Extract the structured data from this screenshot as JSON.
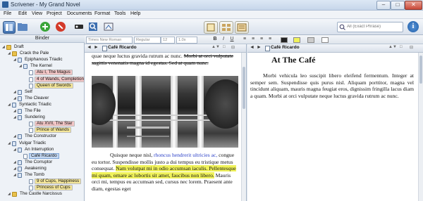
{
  "window": {
    "title": "Scrivener - My Grand Novel",
    "controls": [
      "–",
      "□",
      "✕"
    ]
  },
  "menu": [
    "File",
    "Edit",
    "View",
    "Project",
    "Documents",
    "Format",
    "Tools",
    "Help"
  ],
  "toolbar": {
    "icons": [
      "binder-toggle-icon",
      "folder-icon",
      "add-icon",
      "trash-icon",
      "keywords-icon",
      "search-icon",
      "compile-icon",
      "view-document-icon",
      "view-corkboard-icon",
      "view-outline-icon"
    ],
    "search_placeholder": "All (Exact Phrase)",
    "info_label": "i"
  },
  "binder": {
    "header": "Binder",
    "items": [
      {
        "label": "Draft",
        "level": 0,
        "icon": "draft"
      },
      {
        "label": "Crack the Pale",
        "level": 1,
        "icon": "folder"
      },
      {
        "label": "Epiphanous Triadic",
        "level": 2,
        "icon": "docs"
      },
      {
        "label": "The Kernel",
        "level": 3,
        "icon": "docs"
      },
      {
        "label": "Atu I, The Magus",
        "level": 4,
        "icon": "doc",
        "color": "#f3c6c6"
      },
      {
        "label": "4 of Wands, Completion",
        "level": 4,
        "icon": "doc",
        "color": "#f3c6c6"
      },
      {
        "label": "Queen of Swords",
        "level": 4,
        "icon": "doc",
        "color": "#f5e79a"
      },
      {
        "label": "Self",
        "level": 2,
        "icon": "docs"
      },
      {
        "label": "The Cleaver",
        "level": 2,
        "icon": "docs"
      },
      {
        "label": "Syntactic Triadic",
        "level": 1,
        "icon": "docs"
      },
      {
        "label": "The File",
        "level": 2,
        "icon": "docs"
      },
      {
        "label": "Sundering",
        "level": 2,
        "icon": "docs"
      },
      {
        "label": "Atu XVII, The Star",
        "level": 4,
        "icon": "doc",
        "color": "#f3c6c6"
      },
      {
        "label": "Prince of Wands",
        "level": 4,
        "icon": "doc",
        "color": "#f5e79a"
      },
      {
        "label": "The Constructor",
        "level": 2,
        "icon": "docs"
      },
      {
        "label": "Vulgar Triadic",
        "level": 1,
        "icon": "docs"
      },
      {
        "label": "An Interruption",
        "level": 2,
        "icon": "docs"
      },
      {
        "label": "Café Ricardo",
        "level": 3,
        "icon": "doc",
        "selected": true
      },
      {
        "label": "The Corruptor",
        "level": 2,
        "icon": "docs"
      },
      {
        "label": "Awakening",
        "level": 2,
        "icon": "docs"
      },
      {
        "label": "The Tomb",
        "level": 2,
        "icon": "docs"
      },
      {
        "label": "9 of Cups, Happiness",
        "level": 4,
        "icon": "doc",
        "color": "#f5e79a"
      },
      {
        "label": "Princess of Cups",
        "level": 4,
        "icon": "doc",
        "color": "#f5e79a"
      },
      {
        "label": "The Castle Narcissus",
        "level": 1,
        "icon": "folder"
      }
    ]
  },
  "format_bar": {
    "font": "Times New Roman",
    "style": "Regular",
    "size": "12",
    "spacing": "1.0x",
    "bold": "B",
    "italic": "I",
    "underline": "U",
    "align": [
      "≡",
      "≡",
      "≡",
      "≡"
    ]
  },
  "left_editor": {
    "nav_back": "◄",
    "nav_fwd": "►",
    "title": "Café Ricardo",
    "top_text": "quae neque luctus gravida rutrum ac nunc.",
    "top_strike1": "Morbi at orci vulputate",
    "top_strike2": "sagittis venenatis magna id egestas. Sed at quam nunc.",
    "para_a": "Quisque neque nisl, ",
    "para_link": "rhoncus hendrerit ultricies ac,",
    "para_b": "congue eu tortor. Suspendisse mollis justo a dui tempus eu tristique metus consequat. ",
    "para_hl1": "Nam volutpat mi in odio accumsan iaculis. Pellentesque mi quam, ornare ac lobortis sit amet, faucibus non libero.",
    "para_c": " Mauris orci mi, tempus eu accumsan sed, cursus nec lorem. Praesent ante diam, egestas eget"
  },
  "right_editor": {
    "nav_back": "◄",
    "nav_fwd": "►",
    "title": "Café Ricardo",
    "heading": "At The Café",
    "para1": "Morbi vehicula leo suscipit libero eleifend fermentum. Integer at semper sem. Suspendisse quis purus nisl. Aliquam porttitor, magna vel tincidunt aliquam, mauris magna feugiat eros, dignissim fringilla lacus diam a quam. Morbi at orci vulputate neque luctus gravida rutrum ac nunc."
  }
}
